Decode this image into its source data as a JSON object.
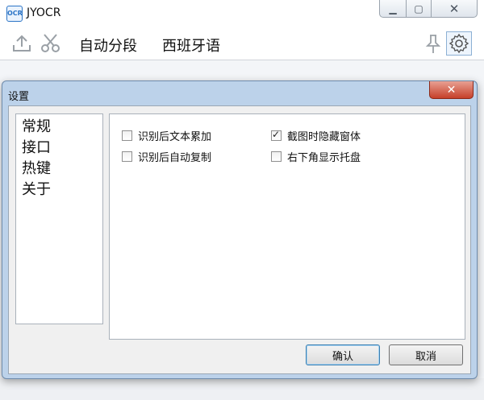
{
  "main_window": {
    "logo_text": "OCR",
    "title": "JYOCR",
    "toolbar": {
      "mode_label": "自动分段",
      "language_label": "西班牙语"
    }
  },
  "dialog": {
    "title": "设置",
    "nav": [
      {
        "label": "常规"
      },
      {
        "label": "接口"
      },
      {
        "label": "热键"
      },
      {
        "label": "关于"
      }
    ],
    "options": [
      {
        "label": "识别后文本累加",
        "checked": false
      },
      {
        "label": "识别后自动复制",
        "checked": false
      },
      {
        "label": "截图时隐藏窗体",
        "checked": true
      },
      {
        "label": "右下角显示托盘",
        "checked": false
      }
    ],
    "ok_label": "确认",
    "cancel_label": "取消"
  },
  "colors": {
    "accent": "#2b74c6",
    "dialog_frame": "#bcd2ea",
    "close_red": "#c6402a"
  }
}
